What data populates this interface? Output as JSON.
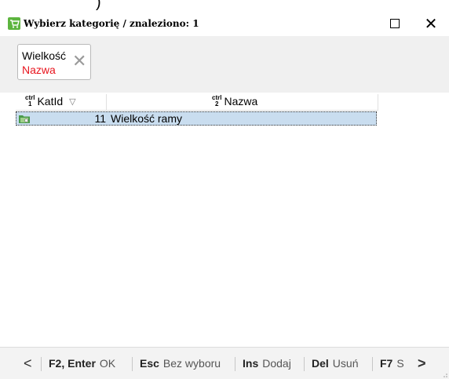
{
  "window": {
    "title": "Wybierz kategorię / znaleziono: 1",
    "maximize_label": "",
    "close_label": "✕"
  },
  "filter": {
    "chip_line1": "Wielkość",
    "chip_line2": "Nazwa",
    "chip_remove": "✕",
    "chip_line2_color": "#e8141d"
  },
  "grid": {
    "columns": [
      {
        "kb_top": "ctrl",
        "kb_bottom": "1",
        "label": "KatId",
        "sort": "▽"
      },
      {
        "kb_top": "ctrl",
        "kb_bottom": "2",
        "label": "Nazwa"
      }
    ],
    "rows": [
      {
        "id": "11",
        "name": "Wielkość ramy",
        "icon": "category-folder-icon"
      }
    ],
    "selected_row_color": "#c9ddef"
  },
  "bottombar": {
    "prev": "<",
    "next": ">",
    "items": [
      {
        "key": "F2, Enter",
        "label": "OK"
      },
      {
        "key": "Esc",
        "label": "Bez wyboru"
      },
      {
        "key": "Ins",
        "label": "Dodaj"
      },
      {
        "key": "Del",
        "label": "Usuń"
      },
      {
        "key": "F7",
        "label": "S"
      }
    ]
  }
}
